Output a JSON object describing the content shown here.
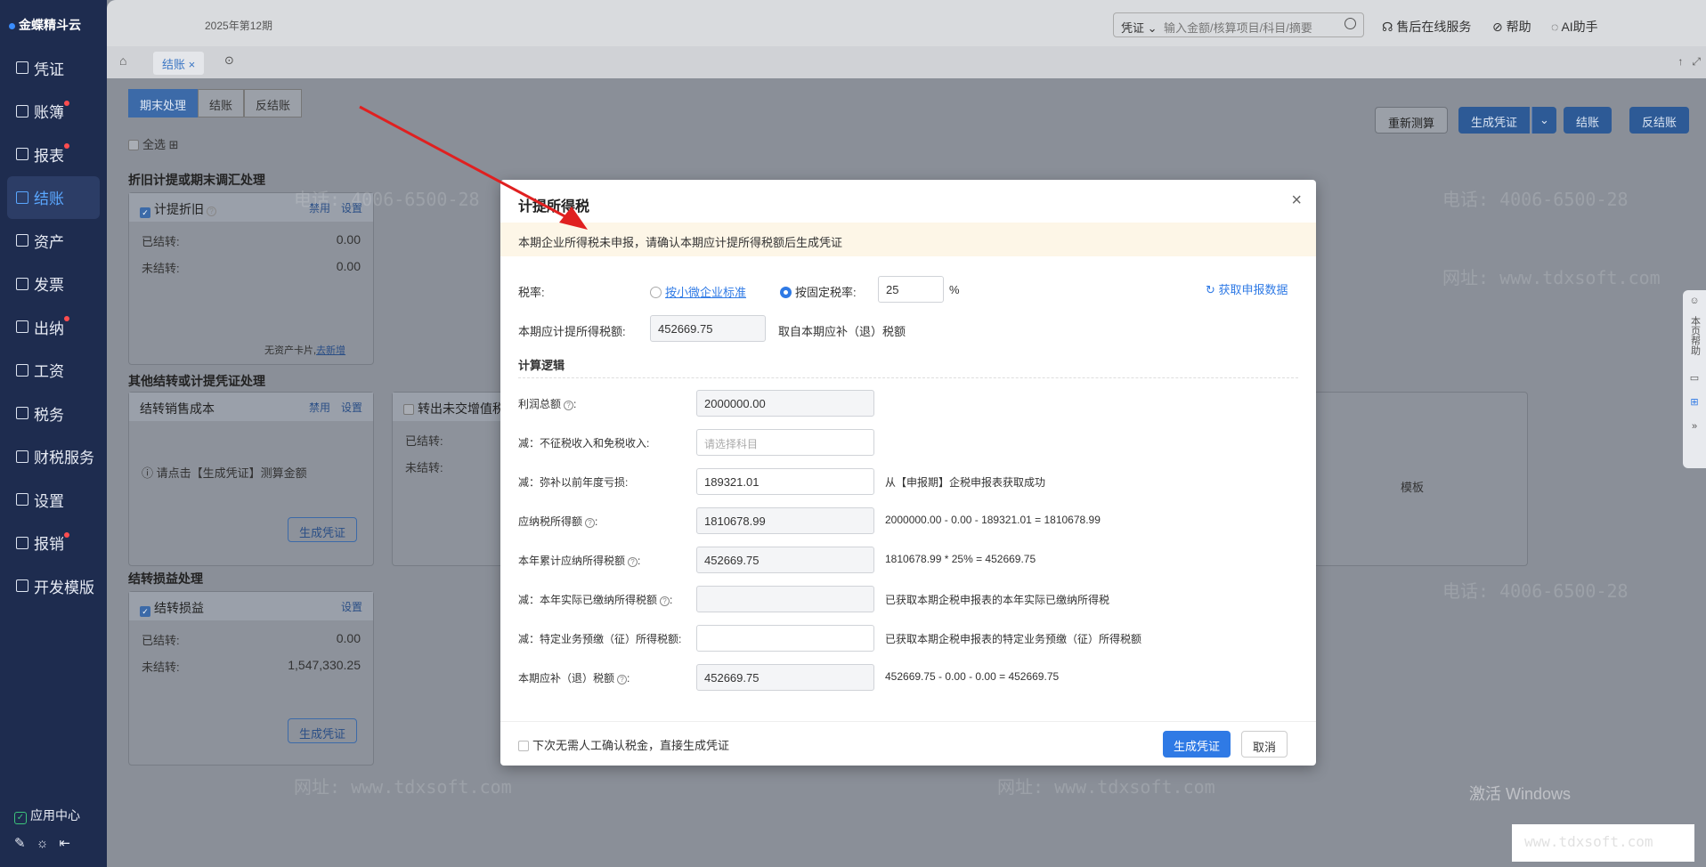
{
  "app": {
    "logo_text": "金蝶精斗云",
    "period": "2025年第12期"
  },
  "sidebar": {
    "items": [
      {
        "label": "凭证",
        "badge": false
      },
      {
        "label": "账簿",
        "badge": true
      },
      {
        "label": "报表",
        "badge": true
      },
      {
        "label": "结账",
        "badge": false,
        "active": true
      },
      {
        "label": "资产",
        "badge": false
      },
      {
        "label": "发票",
        "badge": false
      },
      {
        "label": "出纳",
        "badge": true
      },
      {
        "label": "工资",
        "badge": false
      },
      {
        "label": "税务",
        "badge": false
      },
      {
        "label": "财税服务",
        "badge": false
      },
      {
        "label": "设置",
        "badge": false
      },
      {
        "label": "报销",
        "badge": true
      },
      {
        "label": "开发模版",
        "badge": false
      }
    ],
    "app_center": "应用中心"
  },
  "topbar": {
    "search_select": "凭证",
    "search_placeholder": "输入金额/核算项目/科目/摘要",
    "links": [
      "售后在线服务",
      "帮助",
      "AI助手"
    ]
  },
  "tabs": {
    "active": "结账"
  },
  "page": {
    "segments": [
      "期末处理",
      "结账",
      "反结账"
    ],
    "select_all": "全选",
    "sections": [
      "折旧计提或期末调汇处理",
      "其他结转或计提凭证处理",
      "结转损益处理"
    ],
    "actions": [
      "重新测算",
      "生成凭证",
      "结账",
      "反结账"
    ],
    "card_depr": {
      "title": "计提折旧",
      "disable": "禁用",
      "settings": "设置",
      "done_label": "已结转:",
      "done_val": "0.00",
      "undone_label": "未结转:",
      "undone_val": "0.00",
      "no_asset": "无资产卡片,",
      "add_new": "去新增"
    },
    "card_cost": {
      "title": "结转销售成本",
      "disable": "禁用",
      "settings": "设置",
      "hint": "请点击【生成凭证】测算金额",
      "btn": "生成凭证"
    },
    "card_out": {
      "title": "转出未交增值税",
      "done_label": "已结转:",
      "undone_label": "未结转:"
    },
    "card_pl": {
      "title": "结转损益",
      "settings": "设置",
      "done_label": "已结转:",
      "done_val": "0.00",
      "undone_label": "未结转:",
      "undone_val": "1,547,330.25",
      "btn": "生成凭证"
    },
    "template_text": "模板",
    "dock": [
      "本页帮助"
    ],
    "watermark_phone": "电话: 4006-6500-28",
    "watermark_url": "网址: www.tdxsoft.com",
    "windows_text": "激活 Windows",
    "corner_url": "www.tdxsoft.com"
  },
  "modal": {
    "title": "计提所得税",
    "warning": "本期企业所得税未申报，请确认本期应计提所得税额后生成凭证",
    "rate_label": "税率:",
    "opt_small": "按小微企业标准",
    "opt_fixed": "按固定税率:",
    "rate_value": "25",
    "percent": "%",
    "fetch": "获取申报数据",
    "accrue_label": "本期应计提所得税额:",
    "accrue_value": "452669.75",
    "accrue_note": "取自本期应补（退）税额",
    "logic_title": "计算逻辑",
    "rows": [
      {
        "label": "利润总额",
        "value": "2000000.00",
        "note": ""
      },
      {
        "label": "减：不征税收入和免税收入:",
        "value": "",
        "placeholder": "请选择科目",
        "note": ""
      },
      {
        "label": "减：弥补以前年度亏损:",
        "value": "189321.01",
        "note": "从【申报期】企税申报表获取成功"
      },
      {
        "label": "应纳税所得额",
        "value": "1810678.99",
        "note": "2000000.00 - 0.00 - 189321.01 = 1810678.99"
      },
      {
        "label": "本年累计应纳所得税额",
        "value": "452669.75",
        "note": "1810678.99 * 25% = 452669.75"
      },
      {
        "label": "减：本年实际已缴纳所得税额",
        "value": "",
        "note": "已获取本期企税申报表的本年实际已缴纳所得税"
      },
      {
        "label": "减：特定业务预缴（征）所得税额:",
        "value": "",
        "note": "已获取本期企税申报表的特定业务预缴（征）所得税额"
      },
      {
        "label": "本期应补（退）税额",
        "value": "452669.75",
        "note": "452669.75 - 0.00 - 0.00 = 452669.75"
      }
    ],
    "footer_check": "下次无需人工确认税金，直接生成凭证",
    "btn_generate": "生成凭证",
    "btn_cancel": "取消"
  }
}
